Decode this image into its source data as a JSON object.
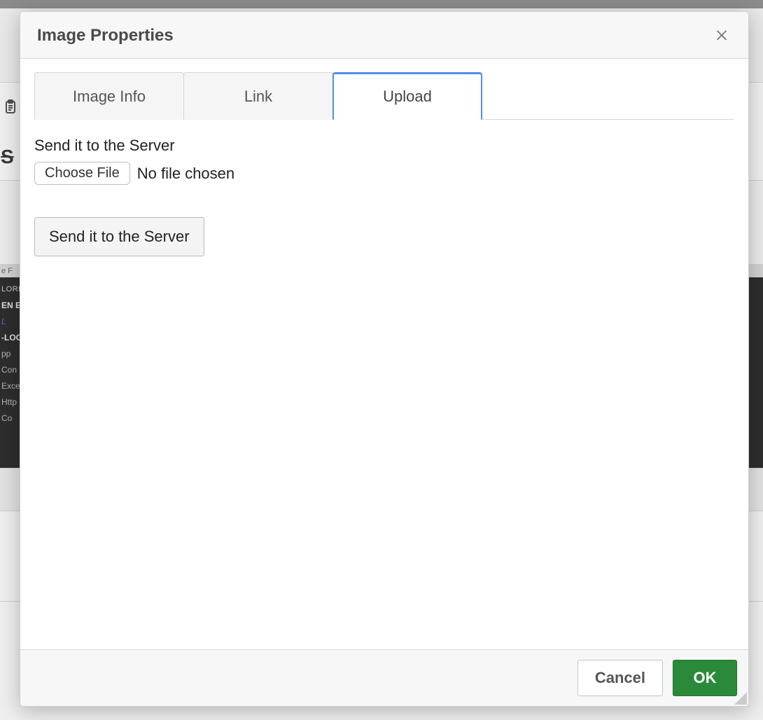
{
  "modal": {
    "title": "Image Properties",
    "tabs": [
      {
        "label": "Image Info",
        "active": false
      },
      {
        "label": "Link",
        "active": false
      },
      {
        "label": "Upload",
        "active": true
      }
    ],
    "upload": {
      "section_label": "Send it to the Server",
      "choose_file_label": "Choose File",
      "file_status": "No file chosen",
      "send_button_label": "Send it to the Server"
    },
    "footer": {
      "cancel_label": "Cancel",
      "ok_label": "OK"
    }
  },
  "background": {
    "strike_char": "S",
    "menubar_fragment": "e   F",
    "sidebar_lines": [
      "LORE",
      "EN ED",
      "L",
      "-LOG",
      "pp",
      "Con",
      "Exce",
      "Http",
      "Co"
    ]
  },
  "colors": {
    "accent_tab": "#4f8fe8",
    "ok_button": "#2a8a3a"
  }
}
